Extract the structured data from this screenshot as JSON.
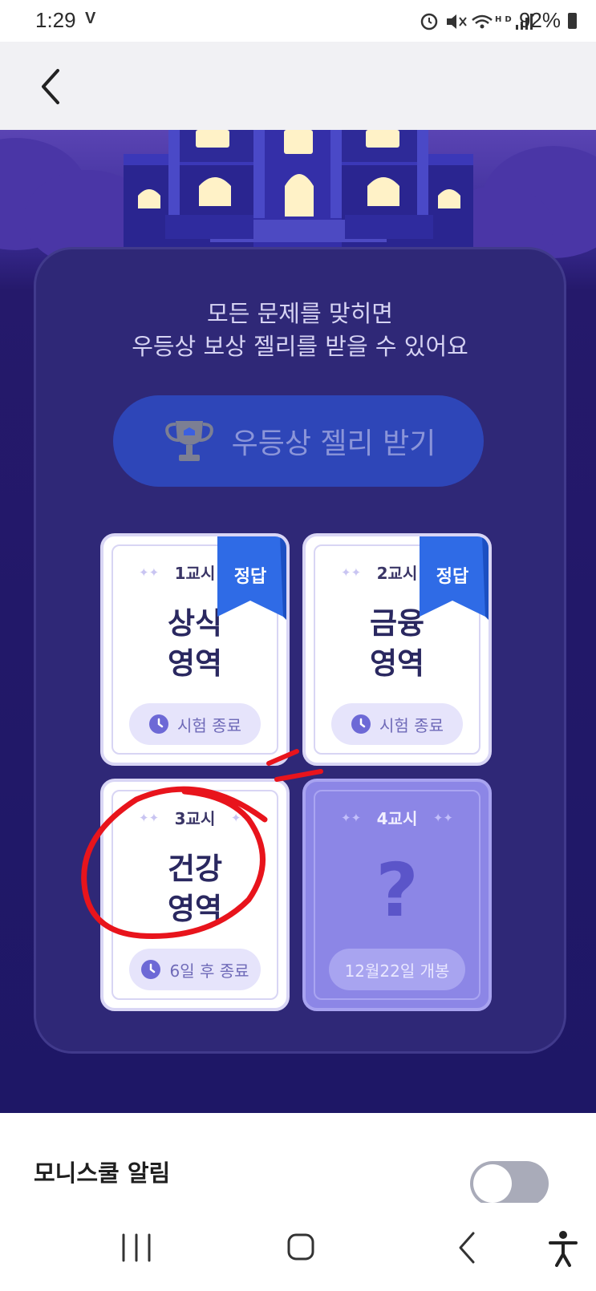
{
  "status_bar": {
    "time": "1:29",
    "carrier": "V",
    "battery": "92%"
  },
  "panel": {
    "message_line1": "모든 문제를 맞히면",
    "message_line2": "우등상 보상 젤리를 받을 수 있어요",
    "reward_button": "우등상 젤리 받기"
  },
  "cards": [
    {
      "period": "1교시",
      "title_line1": "상식",
      "title_line2": "영역",
      "status": "시험 종료",
      "badge": "정답",
      "locked": false
    },
    {
      "period": "2교시",
      "title_line1": "금융",
      "title_line2": "영역",
      "status": "시험 종료",
      "badge": "정답",
      "locked": false
    },
    {
      "period": "3교시",
      "title_line1": "건강",
      "title_line2": "영역",
      "status": "6일 후 종료",
      "badge": "",
      "locked": false
    },
    {
      "period": "4교시",
      "title_line1": "?",
      "title_line2": "",
      "status": "12월22일 개봉",
      "badge": "",
      "locked": true
    }
  ],
  "notification": {
    "label": "모니스쿨 알림",
    "toggle_on": false
  },
  "colors": {
    "accent": "#2e46b8",
    "ribbon": "#2f6be6",
    "annotation": "#e8141c"
  },
  "icons": [
    "back-arrow-icon",
    "trophy-icon",
    "clock-icon",
    "recent-apps-icon",
    "home-icon",
    "nav-back-icon",
    "accessibility-icon"
  ]
}
